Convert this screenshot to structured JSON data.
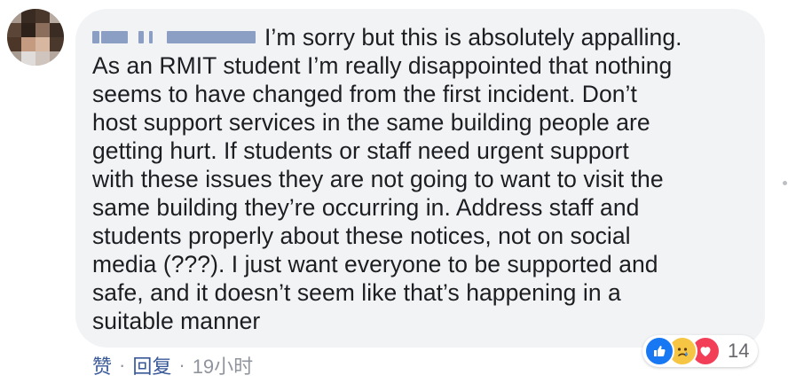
{
  "comment": {
    "author_redacted": true,
    "text_lines": [
      "I’m sorry but this is absolutely appalling.",
      "As an RMIT student I’m really disappointed that nothing",
      "seems to have changed from the first incident. Don’t",
      "host support services in the same building people are",
      "getting hurt. If students or staff need urgent support",
      "with these issues they are not going to want to visit the",
      "same building they’re occurring in. Address staff and",
      "students properly about these notices, not on social",
      "media (???). I just want everyone to be supported and",
      "safe, and it doesn’t seem like that’s happening in a",
      "suitable manner"
    ]
  },
  "reactions": {
    "icons": [
      "like-icon",
      "sad-icon",
      "love-icon"
    ],
    "count": "14",
    "colors": {
      "like": "#1877f2",
      "sad": "#f7c544",
      "love": "#f33e58"
    }
  },
  "actions": {
    "like_label": "赞",
    "separator": "·",
    "reply_label": "回复",
    "timestamp": "19小时"
  },
  "colors": {
    "bubble": "#f2f3f5",
    "text": "#1c1e21",
    "link": "#385898",
    "meta": "#90949c"
  }
}
